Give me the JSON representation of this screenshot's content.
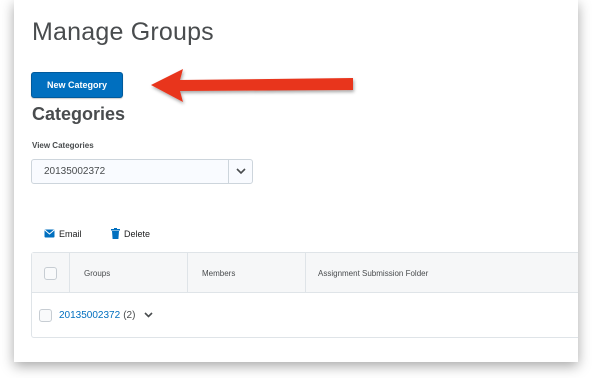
{
  "page": {
    "title": "Manage Groups"
  },
  "actions": {
    "new_category_label": "New Category"
  },
  "categories": {
    "heading": "Categories",
    "view_label": "View Categories",
    "selected": "20135002372"
  },
  "toolbar": {
    "email_label": "Email",
    "delete_label": "Delete"
  },
  "table": {
    "columns": [
      "Groups",
      "Members",
      "Assignment Submission Folder"
    ],
    "rows": [
      {
        "name": "20135002372",
        "count": "(2)"
      }
    ]
  },
  "colors": {
    "accent": "#006fbf",
    "annotation_arrow": "#e8361e"
  },
  "icons": [
    "email-icon",
    "trash-icon",
    "chevron-down-icon",
    "annotation-arrow"
  ]
}
